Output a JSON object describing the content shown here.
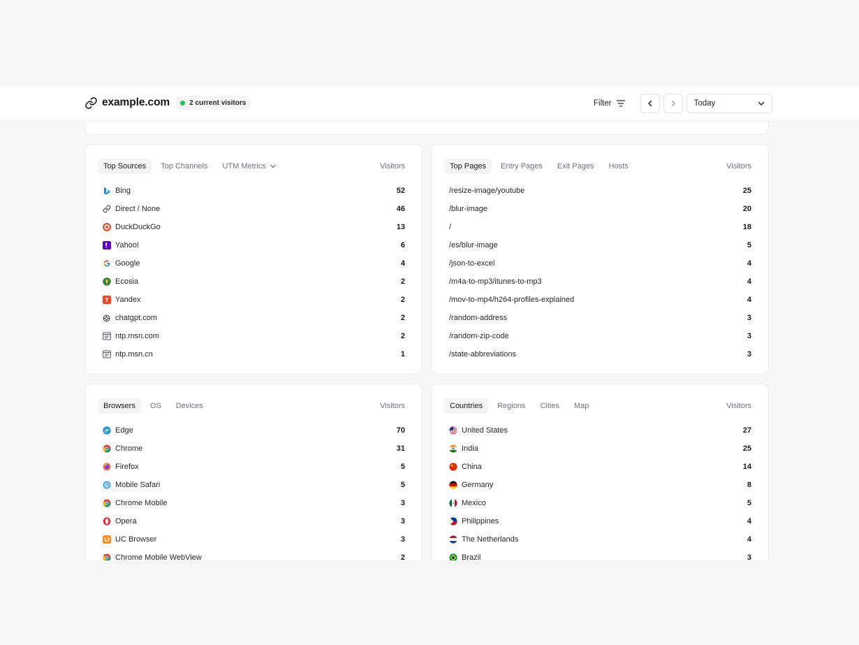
{
  "header": {
    "domain": "example.com",
    "current_visitors": "2 current visitors",
    "filter_label": "Filter",
    "date_range": "Today"
  },
  "sources_card": {
    "tabs": [
      "Top Sources",
      "Top Channels",
      "UTM Metrics"
    ],
    "active_tab": "Top Sources",
    "column": "Visitors",
    "rows": [
      {
        "label": "Bing",
        "value": "52",
        "icon": "bing-icon"
      },
      {
        "label": "Direct / None",
        "value": "46",
        "icon": "link-icon"
      },
      {
        "label": "DuckDuckGo",
        "value": "13",
        "icon": "duckduckgo-icon"
      },
      {
        "label": "Yahoo!",
        "value": "6",
        "icon": "yahoo-icon"
      },
      {
        "label": "Google",
        "value": "4",
        "icon": "google-icon"
      },
      {
        "label": "Ecosia",
        "value": "2",
        "icon": "ecosia-icon"
      },
      {
        "label": "Yandex",
        "value": "2",
        "icon": "yandex-icon"
      },
      {
        "label": "chatgpt.com",
        "value": "2",
        "icon": "chatgpt-icon"
      },
      {
        "label": "ntp.msn.com",
        "value": "2",
        "icon": "browser-window-icon"
      },
      {
        "label": "ntp.msn.cn",
        "value": "1",
        "icon": "browser-window-icon"
      }
    ]
  },
  "pages_card": {
    "tabs": [
      "Top Pages",
      "Entry Pages",
      "Exit Pages",
      "Hosts"
    ],
    "active_tab": "Top Pages",
    "column": "Visitors",
    "rows": [
      {
        "label": "/resize-image/youtube",
        "value": "25"
      },
      {
        "label": "/blur-image",
        "value": "20"
      },
      {
        "label": "/",
        "value": "18"
      },
      {
        "label": "/es/blur-image",
        "value": "5"
      },
      {
        "label": "/json-to-excel",
        "value": "4"
      },
      {
        "label": "/m4a-to-mp3/itunes-to-mp3",
        "value": "4"
      },
      {
        "label": "/mov-to-mp4/h264-profiles-explained",
        "value": "4"
      },
      {
        "label": "/random-address",
        "value": "3"
      },
      {
        "label": "/random-zip-code",
        "value": "3"
      },
      {
        "label": "/state-abbreviations",
        "value": "3"
      }
    ]
  },
  "browsers_card": {
    "tabs": [
      "Browsers",
      "OS",
      "Devices"
    ],
    "active_tab": "Browsers",
    "column": "Visitors",
    "rows": [
      {
        "label": "Edge",
        "value": "70",
        "icon": "edge-icon"
      },
      {
        "label": "Chrome",
        "value": "31",
        "icon": "chrome-icon"
      },
      {
        "label": "Firefox",
        "value": "5",
        "icon": "firefox-icon"
      },
      {
        "label": "Mobile Safari",
        "value": "5",
        "icon": "safari-icon"
      },
      {
        "label": "Chrome Mobile",
        "value": "3",
        "icon": "chrome-icon"
      },
      {
        "label": "Opera",
        "value": "3",
        "icon": "opera-icon"
      },
      {
        "label": "UC Browser",
        "value": "3",
        "icon": "uc-browser-icon"
      },
      {
        "label": "Chrome Mobile WebView",
        "value": "2",
        "icon": "chrome-icon"
      }
    ]
  },
  "countries_card": {
    "tabs": [
      "Countries",
      "Regions",
      "Cities",
      "Map"
    ],
    "active_tab": "Countries",
    "column": "Visitors",
    "rows": [
      {
        "label": "United States",
        "value": "27",
        "icon": "flag-us-icon"
      },
      {
        "label": "India",
        "value": "25",
        "icon": "flag-in-icon"
      },
      {
        "label": "China",
        "value": "14",
        "icon": "flag-cn-icon"
      },
      {
        "label": "Germany",
        "value": "8",
        "icon": "flag-de-icon"
      },
      {
        "label": "Mexico",
        "value": "5",
        "icon": "flag-mx-icon"
      },
      {
        "label": "Philippines",
        "value": "4",
        "icon": "flag-ph-icon"
      },
      {
        "label": "The Netherlands",
        "value": "4",
        "icon": "flag-nl-icon"
      },
      {
        "label": "Brazil",
        "value": "3",
        "icon": "flag-br-icon"
      }
    ]
  },
  "colors": {
    "live_dot": "#22c55e",
    "active_tab_bg": "#f4f4f5",
    "page_bg": "#f7f7f8"
  }
}
